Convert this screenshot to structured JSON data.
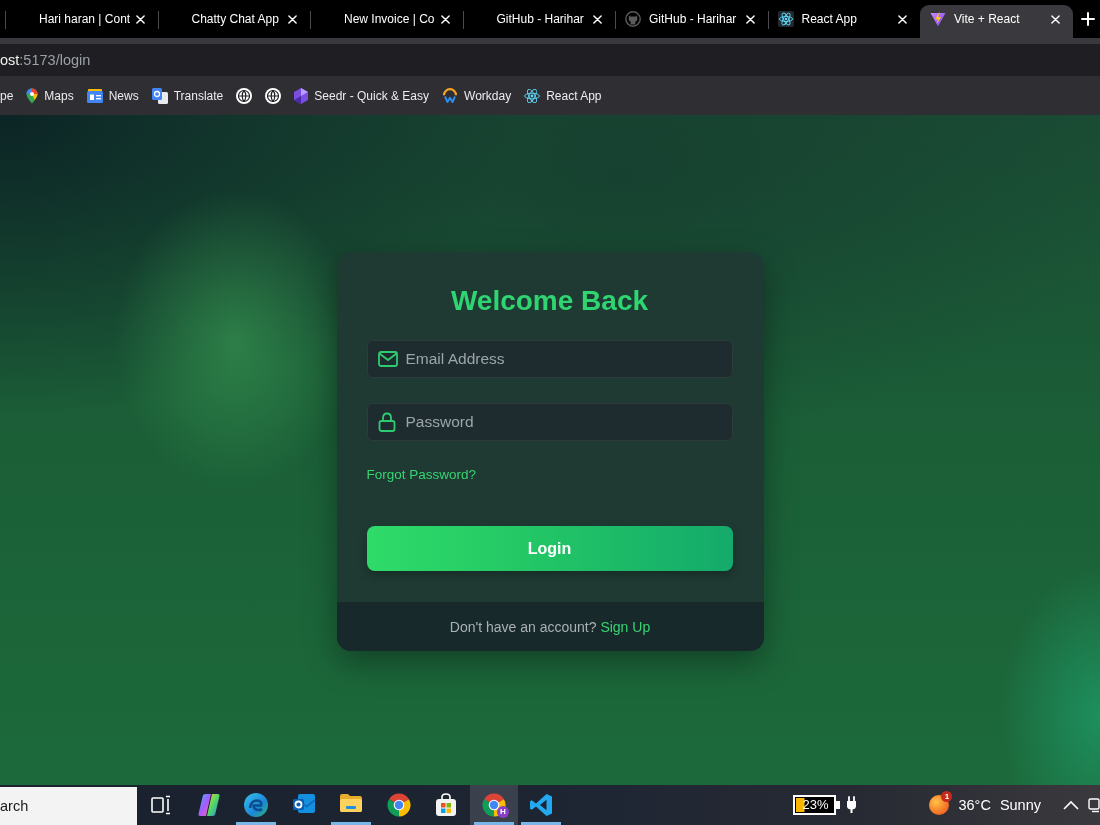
{
  "browser": {
    "tabs": [
      {
        "title": "Hari haran | Cont",
        "selected": false
      },
      {
        "title": "Chatty Chat App",
        "selected": false
      },
      {
        "title": "New Invoice | Co",
        "selected": false
      },
      {
        "title": "GitHub - Harihar",
        "selected": false
      },
      {
        "title": "GitHub - Harihar",
        "selected": false
      },
      {
        "title": "React App",
        "selected": false
      },
      {
        "title": "Vite + React",
        "selected": true
      }
    ],
    "address_bar": {
      "host": "ost",
      "path": ":5173/login"
    },
    "bookmarks": [
      {
        "kind": "text",
        "label": "pe"
      },
      {
        "kind": "labeled",
        "label": "Maps"
      },
      {
        "kind": "labeled",
        "label": "News"
      },
      {
        "kind": "labeled",
        "label": "Translate"
      },
      {
        "kind": "icon"
      },
      {
        "kind": "icon"
      },
      {
        "kind": "labeled",
        "label": "Seedr - Quick & Easy"
      },
      {
        "kind": "labeled",
        "label": "Workday"
      },
      {
        "kind": "labeled",
        "label": "React App"
      }
    ]
  },
  "login_card": {
    "title": "Welcome Back",
    "fields": [
      {
        "kind": "email",
        "placeholder": "Email Address"
      },
      {
        "kind": "password",
        "placeholder": "Password"
      }
    ],
    "forgot_link": "Forgot Password?",
    "submit_button": "Login",
    "footer": {
      "text": "Don't have an account?",
      "link": "Sign Up"
    }
  },
  "taskbar": {
    "search": {
      "placeholder": "arch"
    },
    "apps": [
      {
        "running": false,
        "active": false
      },
      {
        "running": true,
        "active": false
      },
      {
        "running": false,
        "active": false
      },
      {
        "running": true,
        "active": false
      },
      {
        "running": false,
        "active": false
      },
      {
        "running": false,
        "active": false
      },
      {
        "running": true,
        "active": true,
        "badge": "H"
      },
      {
        "running": true,
        "active": false
      }
    ],
    "battery": {
      "level": 0.23,
      "reading": "23%",
      "charging": true
    },
    "weather": {
      "badge": "1",
      "temperature": "36°C",
      "condition": "Sunny"
    }
  }
}
